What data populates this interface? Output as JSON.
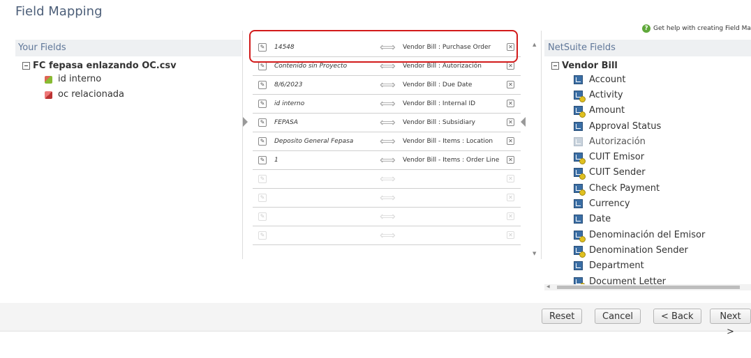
{
  "title": "Field Mapping",
  "help_text": "Get help with creating Field Map",
  "left": {
    "header": "Your Fields",
    "file": "FC fepasa enlazando OC.csv",
    "fields": [
      {
        "label": "id interno",
        "icon": "green-cube-icon"
      },
      {
        "label": "oc relacionada",
        "icon": "red-cube-icon"
      }
    ]
  },
  "mappings": [
    {
      "source": "14548",
      "target": "Vendor Bill : Purchase Order"
    },
    {
      "source": "Contenido sin Proyecto",
      "target": "Vendor Bill : Autorización"
    },
    {
      "source": "8/6/2023",
      "target": "Vendor Bill : Due Date"
    },
    {
      "source": "id interno",
      "target": "Vendor Bill : Internal ID"
    },
    {
      "source": "FEPASA",
      "target": "Vendor Bill : Subsidiary"
    },
    {
      "source": "Deposito General Fepasa",
      "target": "Vendor Bill - Items : Location"
    },
    {
      "source": "1",
      "target": "Vendor Bill - Items : Order Line"
    }
  ],
  "right": {
    "header": "NetSuite Fields",
    "record": "Vendor Bill",
    "fields": [
      {
        "label": "Account",
        "type": "standard"
      },
      {
        "label": "Activity",
        "type": "custom"
      },
      {
        "label": "Amount",
        "type": "custom"
      },
      {
        "label": "Approval Status",
        "type": "standard"
      },
      {
        "label": "Autorización",
        "type": "disabled"
      },
      {
        "label": "CUIT Emisor",
        "type": "custom"
      },
      {
        "label": "CUIT Sender",
        "type": "custom"
      },
      {
        "label": "Check Payment",
        "type": "custom"
      },
      {
        "label": "Currency",
        "type": "standard"
      },
      {
        "label": "Date",
        "type": "standard"
      },
      {
        "label": "Denominación del Emisor",
        "type": "custom"
      },
      {
        "label": "Denomination Sender",
        "type": "custom"
      },
      {
        "label": "Department",
        "type": "standard"
      },
      {
        "label": "Document Letter",
        "type": "custom"
      }
    ]
  },
  "buttons": {
    "reset": "Reset",
    "cancel": "Cancel",
    "back": "< Back",
    "next": "Next >"
  },
  "colors": {
    "highlight": "#d21a1a",
    "header_text": "#607799",
    "title": "#4d5f79"
  }
}
